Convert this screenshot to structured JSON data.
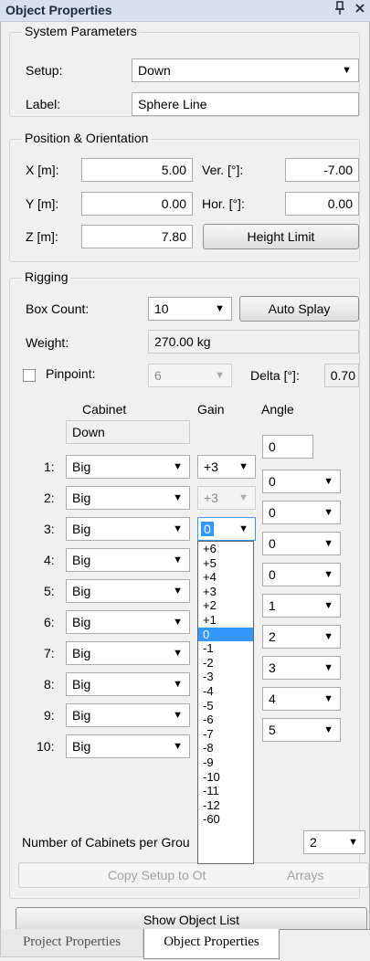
{
  "window": {
    "title": "Object Properties",
    "pin_glyph": "q",
    "close_glyph": "✕"
  },
  "system": {
    "legend": "System Parameters",
    "setup_label": "Setup:",
    "setup_value": "Down",
    "label_label": "Label:",
    "label_value": "Sphere Line"
  },
  "position": {
    "legend": "Position & Orientation",
    "x_label": "X [m]:",
    "x_value": "5.00",
    "y_label": "Y [m]:",
    "y_value": "0.00",
    "z_label": "Z [m]:",
    "z_value": "7.80",
    "ver_label": "Ver. [°]:",
    "ver_value": "-7.00",
    "hor_label": "Hor. [°]:",
    "hor_value": "0.00",
    "height_limit": "Height Limit"
  },
  "rigging": {
    "legend": "Rigging",
    "box_count_label": "Box Count:",
    "box_count_value": "10",
    "auto_splay": "Auto Splay",
    "weight_label": "Weight:",
    "weight_value": "270.00 kg",
    "pinpoint_label": "Pinpoint:",
    "pinpoint_value": "6",
    "delta_label": "Delta [°]:",
    "delta_value": "0.70",
    "col_cabinet": "Cabinet",
    "col_gain": "Gain",
    "col_angle": "Angle",
    "top_cabinet": "Down",
    "top_angle": "0",
    "rows": [
      {
        "num": "1:",
        "cabinet": "Big",
        "gain": "+3"
      },
      {
        "num": "2:",
        "cabinet": "Big",
        "gain": "+3"
      },
      {
        "num": "3:",
        "cabinet": "Big",
        "gain": "0"
      },
      {
        "num": "4:",
        "cabinet": "Big"
      },
      {
        "num": "5:",
        "cabinet": "Big"
      },
      {
        "num": "6:",
        "cabinet": "Big"
      },
      {
        "num": "7:",
        "cabinet": "Big"
      },
      {
        "num": "8:",
        "cabinet": "Big"
      },
      {
        "num": "9:",
        "cabinet": "Big"
      },
      {
        "num": "10:",
        "cabinet": "Big"
      }
    ],
    "angles": [
      "0",
      "0",
      "0",
      "0",
      "1",
      "2",
      "3",
      "4",
      "5"
    ],
    "gain_options": [
      "+6",
      "+5",
      "+4",
      "+3",
      "+2",
      "+1",
      "0",
      "-1",
      "-2",
      "-3",
      "-4",
      "-5",
      "-6",
      "-7",
      "-8",
      "-9",
      "-10",
      "-11",
      "-12",
      "-60"
    ],
    "gain_selected": "0",
    "cabinets_per_group_label": "Number of Cabinets per Grou",
    "cabinets_per_group_value": "2",
    "copy_setup": "Copy Setup to Ot",
    "copy_setup_tail": "Arrays"
  },
  "show_object_list": "Show Object List",
  "tabs": {
    "project": "Project Properties",
    "object": "Object Properties"
  }
}
